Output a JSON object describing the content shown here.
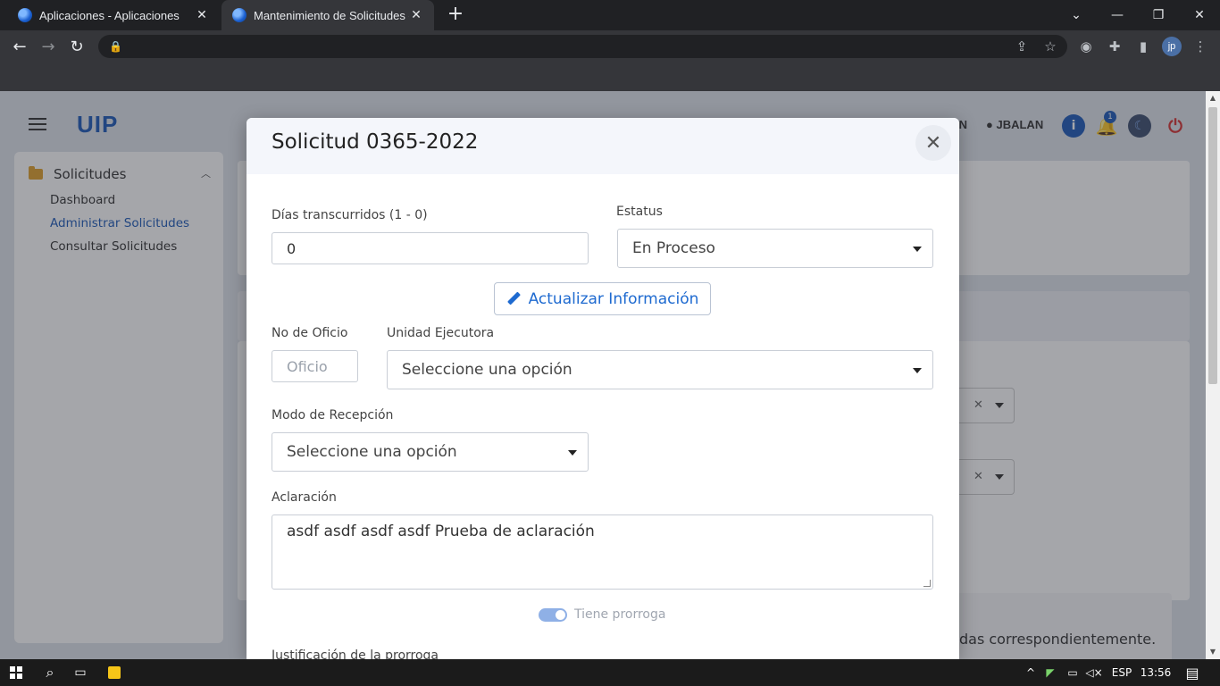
{
  "browser": {
    "tabs": [
      {
        "title": "Aplicaciones - Aplicaciones"
      },
      {
        "title": "Mantenimiento de Solicitudes - In"
      }
    ],
    "profile_initials": "jp"
  },
  "app": {
    "brand": "UIP",
    "header": {
      "partial_text": "IN",
      "user": "JBALAN",
      "notification_count": "1"
    },
    "sidebar": {
      "group_label": "Solicitudes",
      "items": [
        {
          "label": "Dashboard"
        },
        {
          "label": "Administrar Solicitudes"
        },
        {
          "label": "Consultar Solicitudes"
        }
      ]
    },
    "background_text": "das correspondientemente."
  },
  "modal": {
    "title": "Solicitud 0365-2022",
    "dias_label": "Días transcurridos (1 - 0)",
    "dias_value": "0",
    "estatus_label": "Estatus",
    "estatus_value": "En Proceso",
    "update_button": "Actualizar Información",
    "oficio_label": "No de Oficio",
    "oficio_placeholder": "Oficio",
    "unidad_label": "Unidad Ejecutora",
    "unidad_value": "Seleccione una opción",
    "modo_label": "Modo de Recepción",
    "modo_value": "Seleccione una opción",
    "aclaracion_label": "Aclaración",
    "aclaracion_value": "asdf asdf asdf asdf Prueba de aclaración",
    "prorroga_label": "Tiene prorroga",
    "prorroga_on": true,
    "justificacion_label": "Justificación de la prorroga"
  },
  "taskbar": {
    "language": "ESP",
    "time": "13:56"
  },
  "colors": {
    "accent": "#1e5bb8",
    "folder": "#e0a12b",
    "power": "#d63333"
  }
}
